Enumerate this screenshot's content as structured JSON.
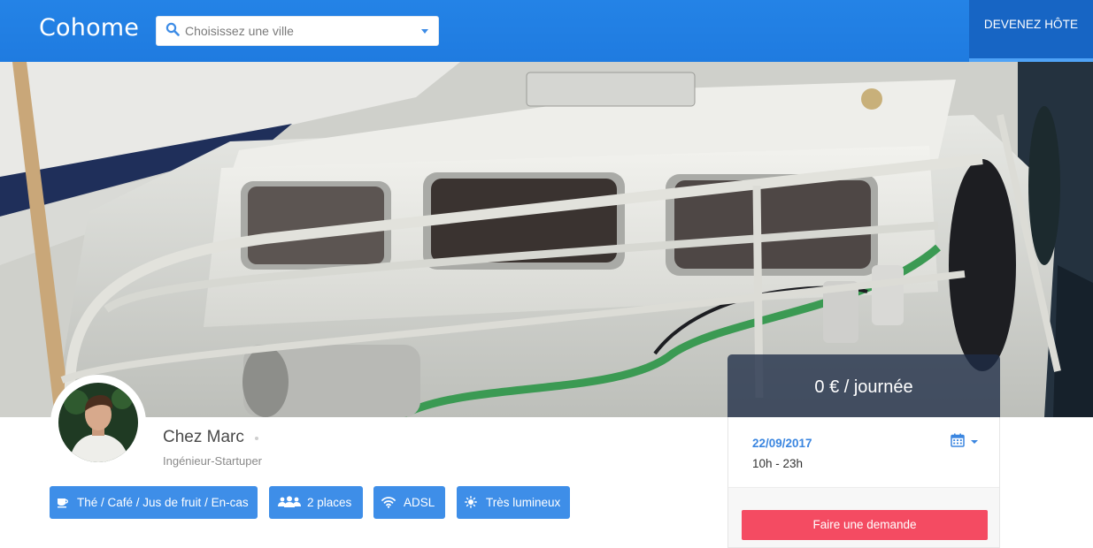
{
  "header": {
    "logo": "Cohome",
    "search": {
      "placeholder": "Choisissez une ville",
      "value": ""
    },
    "host_button": "DEVENEZ HÔTE"
  },
  "host": {
    "name": "Chez Marc",
    "job": "Ingénieur-Startuper"
  },
  "tags": [
    {
      "label": "Thé / Café / Jus de fruit / En-cas",
      "icon": "coffee-cup-icon"
    },
    {
      "label": "2 places",
      "icon": "people-icon"
    },
    {
      "label": "ADSL",
      "icon": "wifi-icon"
    },
    {
      "label": "Très lumineux",
      "icon": "sun-icon"
    }
  ],
  "booking": {
    "price": "0 € / journée",
    "date": "22/09/2017",
    "hours": "10h - 23h",
    "request_button": "Faire une demande"
  },
  "colors": {
    "header_blue": "#2483e6",
    "host_button_bg": "#1765c4",
    "tag_blue": "#3e8ee8",
    "request_red": "#f44b62",
    "date_blue": "#3b86e0"
  }
}
